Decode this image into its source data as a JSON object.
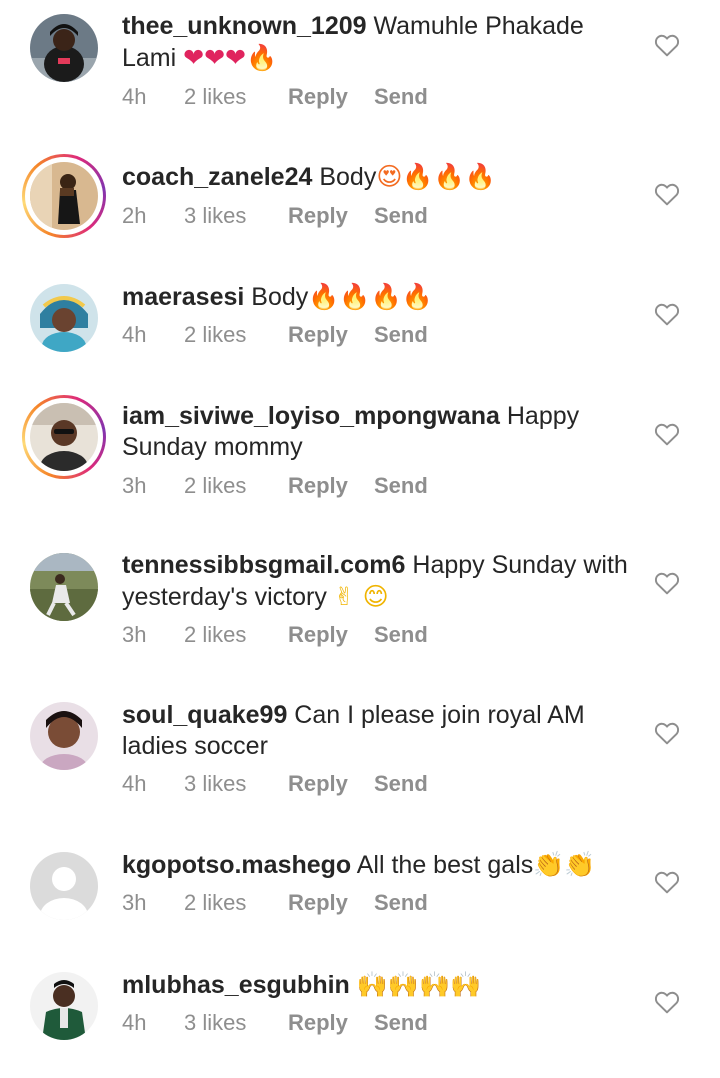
{
  "comments": [
    {
      "username": "thee_unknown_1209",
      "text": " Wamuhle Phakade Lami ",
      "emoji": "❤❤❤🔥",
      "time": "4h",
      "likes": "2 likes",
      "reply": "Reply",
      "send": "Send"
    },
    {
      "username": "coach_zanele24",
      "text": " Body",
      "emoji": "😍🔥🔥🔥",
      "time": "2h",
      "likes": "3 likes",
      "reply": "Reply",
      "send": "Send"
    },
    {
      "username": "maerasesi",
      "text": " Body",
      "emoji": "🔥🔥🔥🔥",
      "time": "4h",
      "likes": "2 likes",
      "reply": "Reply",
      "send": "Send"
    },
    {
      "username": "iam_siviwe_loyiso_mpongwana",
      "text": " Happy Sunday mommy",
      "emoji": "",
      "time": "3h",
      "likes": "2 likes",
      "reply": "Reply",
      "send": "Send"
    },
    {
      "username": "tennessibbsgmail.com6",
      "text": " Happy Sunday with yesterday's victory ",
      "emoji": "✌ 😊",
      "time": "3h",
      "likes": "2 likes",
      "reply": "Reply",
      "send": "Send"
    },
    {
      "username": "soul_quake99",
      "text": " Can I please join royal AM ladies soccer",
      "emoji": "",
      "time": "4h",
      "likes": "3 likes",
      "reply": "Reply",
      "send": "Send"
    },
    {
      "username": "kgopotso.mashego",
      "text": " All the best  gals",
      "emoji": "👏👏",
      "time": "3h",
      "likes": "2 likes",
      "reply": "Reply",
      "send": "Send"
    },
    {
      "username": "mlubhas_esgubhin",
      "text": " ",
      "emoji": "🙌🙌🙌🙌",
      "time": "4h",
      "likes": "3 likes",
      "reply": "Reply",
      "send": "Send"
    }
  ],
  "icons": {
    "like": "heart-outline-icon",
    "default_avatar": "default-avatar-icon"
  },
  "colors": {
    "meta_text": "#8e8e8e",
    "primary_text": "#262626",
    "story_ring": "#dd2a7b"
  }
}
